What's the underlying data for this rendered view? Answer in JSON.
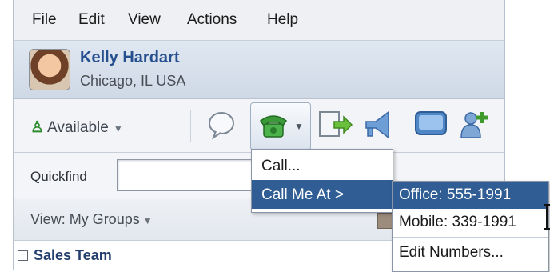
{
  "menubar": {
    "items": [
      "File",
      "Edit",
      "View",
      "Actions",
      "Help"
    ]
  },
  "profile": {
    "name": "Kelly Hardart",
    "location": "Chicago, IL USA"
  },
  "toolbar": {
    "status_label": "Available",
    "icons": [
      "chat-icon",
      "phone-icon",
      "transfer-icon",
      "broadcast-icon",
      "screen-share-icon",
      "add-contact-icon"
    ]
  },
  "quickfind": {
    "label": "Quickfind",
    "value": ""
  },
  "view": {
    "label": "View: My Groups"
  },
  "groups": [
    {
      "name": "Sales Team",
      "expanded": true
    }
  ],
  "call_menu": {
    "items": [
      "Call...",
      "Call Me At >"
    ],
    "active_index": 1
  },
  "call_me_at_submenu": {
    "items": [
      "Office: 555-1991",
      "Mobile: 339-1991",
      "Edit Numbers..."
    ],
    "active_index": 0
  },
  "colors": {
    "highlight": "#2f5d94",
    "name_blue": "#264f8f",
    "status_green": "#2e8b2e"
  }
}
